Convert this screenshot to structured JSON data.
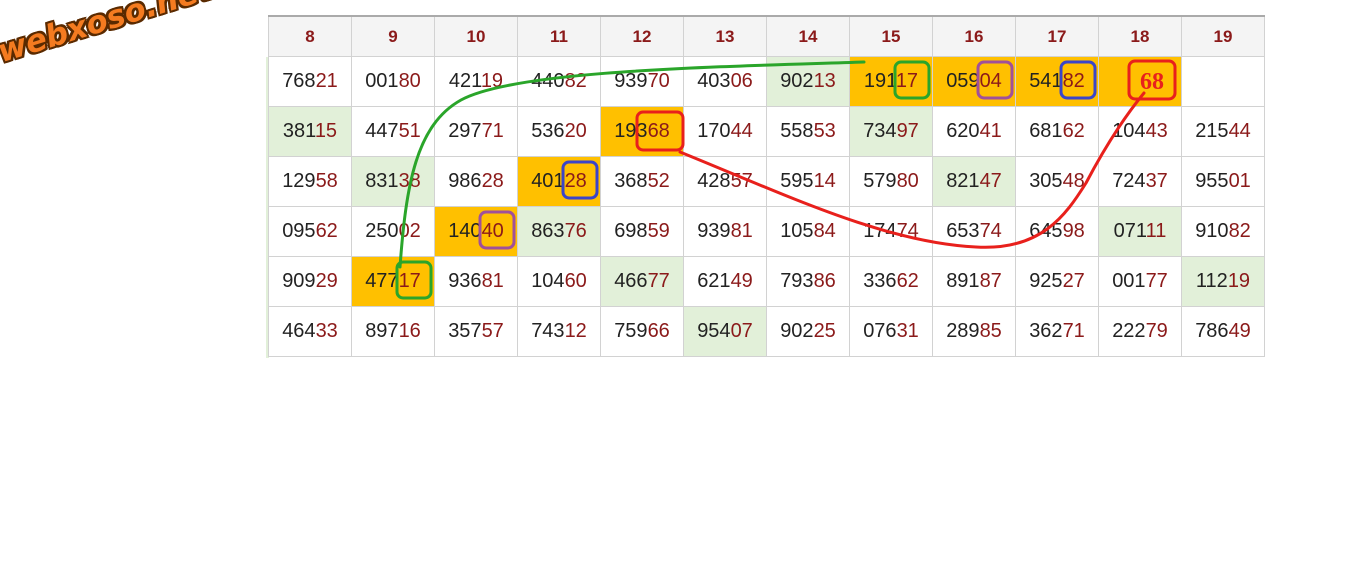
{
  "logo": {
    "text": "webxoso.net"
  },
  "columns": [
    "8",
    "9",
    "10",
    "11",
    "12",
    "13",
    "14",
    "15",
    "16",
    "17",
    "18",
    "19"
  ],
  "rows": [
    [
      {
        "head": "768",
        "tail": "21",
        "bg": "w"
      },
      {
        "head": "001",
        "tail": "80",
        "bg": "w"
      },
      {
        "head": "421",
        "tail": "19",
        "bg": "w"
      },
      {
        "head": "440",
        "tail": "82",
        "bg": "w"
      },
      {
        "head": "939",
        "tail": "70",
        "bg": "w"
      },
      {
        "head": "403",
        "tail": "06",
        "bg": "w"
      },
      {
        "head": "902",
        "tail": "13",
        "bg": "g"
      },
      {
        "head": "191",
        "tail": "17",
        "bg": "y"
      },
      {
        "head": "059",
        "tail": "04",
        "bg": "y"
      },
      {
        "head": "541",
        "tail": "82",
        "bg": "y"
      },
      {
        "head": "",
        "tail": "",
        "bg": "y"
      },
      {
        "head": "",
        "tail": "",
        "bg": "w"
      }
    ],
    [
      {
        "head": "381",
        "tail": "15",
        "bg": "g"
      },
      {
        "head": "447",
        "tail": "51",
        "bg": "w"
      },
      {
        "head": "297",
        "tail": "71",
        "bg": "w"
      },
      {
        "head": "536",
        "tail": "20",
        "bg": "w"
      },
      {
        "head": "193",
        "tail": "68",
        "bg": "y"
      },
      {
        "head": "170",
        "tail": "44",
        "bg": "w"
      },
      {
        "head": "558",
        "tail": "53",
        "bg": "w"
      },
      {
        "head": "734",
        "tail": "97",
        "bg": "g"
      },
      {
        "head": "620",
        "tail": "41",
        "bg": "w"
      },
      {
        "head": "681",
        "tail": "62",
        "bg": "w"
      },
      {
        "head": "104",
        "tail": "43",
        "bg": "w"
      },
      {
        "head": "215",
        "tail": "44",
        "bg": "w"
      }
    ],
    [
      {
        "head": "129",
        "tail": "58",
        "bg": "w"
      },
      {
        "head": "831",
        "tail": "38",
        "bg": "g"
      },
      {
        "head": "986",
        "tail": "28",
        "bg": "w"
      },
      {
        "head": "401",
        "tail": "28",
        "bg": "y"
      },
      {
        "head": "368",
        "tail": "52",
        "bg": "w"
      },
      {
        "head": "428",
        "tail": "57",
        "bg": "w"
      },
      {
        "head": "595",
        "tail": "14",
        "bg": "w"
      },
      {
        "head": "579",
        "tail": "80",
        "bg": "w"
      },
      {
        "head": "821",
        "tail": "47",
        "bg": "g"
      },
      {
        "head": "305",
        "tail": "48",
        "bg": "w"
      },
      {
        "head": "724",
        "tail": "37",
        "bg": "w"
      },
      {
        "head": "955",
        "tail": "01",
        "bg": "w"
      }
    ],
    [
      {
        "head": "095",
        "tail": "62",
        "bg": "w"
      },
      {
        "head": "250",
        "tail": "02",
        "bg": "w"
      },
      {
        "head": "140",
        "tail": "40",
        "bg": "y"
      },
      {
        "head": "863",
        "tail": "76",
        "bg": "g"
      },
      {
        "head": "698",
        "tail": "59",
        "bg": "w"
      },
      {
        "head": "939",
        "tail": "81",
        "bg": "w"
      },
      {
        "head": "105",
        "tail": "84",
        "bg": "w"
      },
      {
        "head": "174",
        "tail": "74",
        "bg": "w"
      },
      {
        "head": "653",
        "tail": "74",
        "bg": "w"
      },
      {
        "head": "645",
        "tail": "98",
        "bg": "w"
      },
      {
        "head": "071",
        "tail": "11",
        "bg": "g"
      },
      {
        "head": "910",
        "tail": "82",
        "bg": "w"
      }
    ],
    [
      {
        "head": "909",
        "tail": "29",
        "bg": "w"
      },
      {
        "head": "477",
        "tail": "17",
        "bg": "y"
      },
      {
        "head": "936",
        "tail": "81",
        "bg": "w"
      },
      {
        "head": "104",
        "tail": "60",
        "bg": "w"
      },
      {
        "head": "466",
        "tail": "77",
        "bg": "g"
      },
      {
        "head": "621",
        "tail": "49",
        "bg": "w"
      },
      {
        "head": "793",
        "tail": "86",
        "bg": "w"
      },
      {
        "head": "336",
        "tail": "62",
        "bg": "w"
      },
      {
        "head": "891",
        "tail": "87",
        "bg": "w"
      },
      {
        "head": "925",
        "tail": "27",
        "bg": "w"
      },
      {
        "head": "001",
        "tail": "77",
        "bg": "w"
      },
      {
        "head": "112",
        "tail": "19",
        "bg": "g"
      }
    ],
    [
      {
        "head": "464",
        "tail": "33",
        "bg": "w"
      },
      {
        "head": "897",
        "tail": "16",
        "bg": "w"
      },
      {
        "head": "357",
        "tail": "57",
        "bg": "w"
      },
      {
        "head": "743",
        "tail": "12",
        "bg": "w"
      },
      {
        "head": "759",
        "tail": "66",
        "bg": "w"
      },
      {
        "head": "954",
        "tail": "07",
        "bg": "g"
      },
      {
        "head": "902",
        "tail": "25",
        "bg": "w"
      },
      {
        "head": "076",
        "tail": "31",
        "bg": "w"
      },
      {
        "head": "289",
        "tail": "85",
        "bg": "w"
      },
      {
        "head": "362",
        "tail": "71",
        "bg": "w"
      },
      {
        "head": "222",
        "tail": "79",
        "bg": "w"
      },
      {
        "head": "786",
        "tail": "49",
        "bg": "w"
      }
    ]
  ],
  "prediction": {
    "value": "68",
    "color": "#e8201c"
  },
  "colors": {
    "green": "#2aa52a",
    "red": "#e8201c",
    "purple": "#a0509a",
    "blue": "#3a45c8",
    "highlight": "#ffc000",
    "cell_green": "#e2f0d9"
  },
  "markers": [
    {
      "name": "green-box-17-top",
      "color": "green",
      "row": 0,
      "col": 7
    },
    {
      "name": "green-box-17-bottom",
      "color": "green",
      "row": 4,
      "col": 1
    },
    {
      "name": "purple-box-04",
      "color": "purple",
      "row": 0,
      "col": 8
    },
    {
      "name": "purple-box-40",
      "color": "purple",
      "row": 3,
      "col": 2
    },
    {
      "name": "blue-box-82",
      "color": "blue",
      "row": 0,
      "col": 9
    },
    {
      "name": "blue-box-28",
      "color": "blue",
      "row": 2,
      "col": 3
    },
    {
      "name": "red-box-68",
      "color": "red",
      "row": 1,
      "col": 4
    },
    {
      "name": "red-box-prediction",
      "color": "red",
      "row": 0,
      "col": 10
    }
  ]
}
